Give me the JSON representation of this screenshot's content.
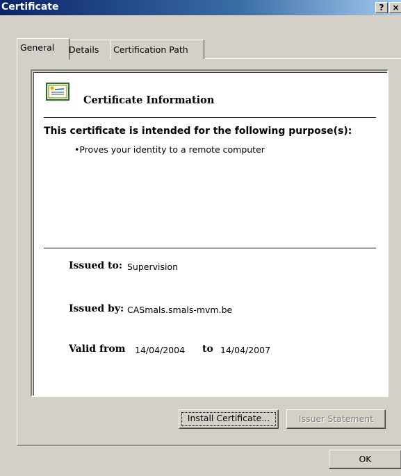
{
  "window": {
    "title": "Certificate",
    "help_label": "?",
    "close_label": "×"
  },
  "tabs": [
    {
      "label": "General",
      "active": true
    },
    {
      "label": "Details",
      "active": false
    },
    {
      "label": "Certification Path",
      "active": false
    }
  ],
  "info": {
    "icon": "certificate-icon",
    "title": "Certificate Information",
    "purpose_heading": "This certificate is intended for the following purpose(s):",
    "purposes": [
      "•Proves your identity to a remote computer"
    ],
    "issued_to_label": "Issued to:",
    "issued_to_value": "Supervision",
    "issued_by_label": "Issued by:",
    "issued_by_value": "CASmals.smals-mvm.be",
    "valid_from_label": "Valid from",
    "valid_from_value": "14/04/2004",
    "valid_to_label": "to",
    "valid_to_value": "14/04/2007"
  },
  "buttons": {
    "install_label": "Install Certificate...",
    "issuer_label": "Issuer Statement",
    "ok_label": "OK"
  },
  "colors": {
    "title_bar": "#0a246a",
    "dialog_bg": "#d4d0c8",
    "disabled_text": "#808080"
  }
}
